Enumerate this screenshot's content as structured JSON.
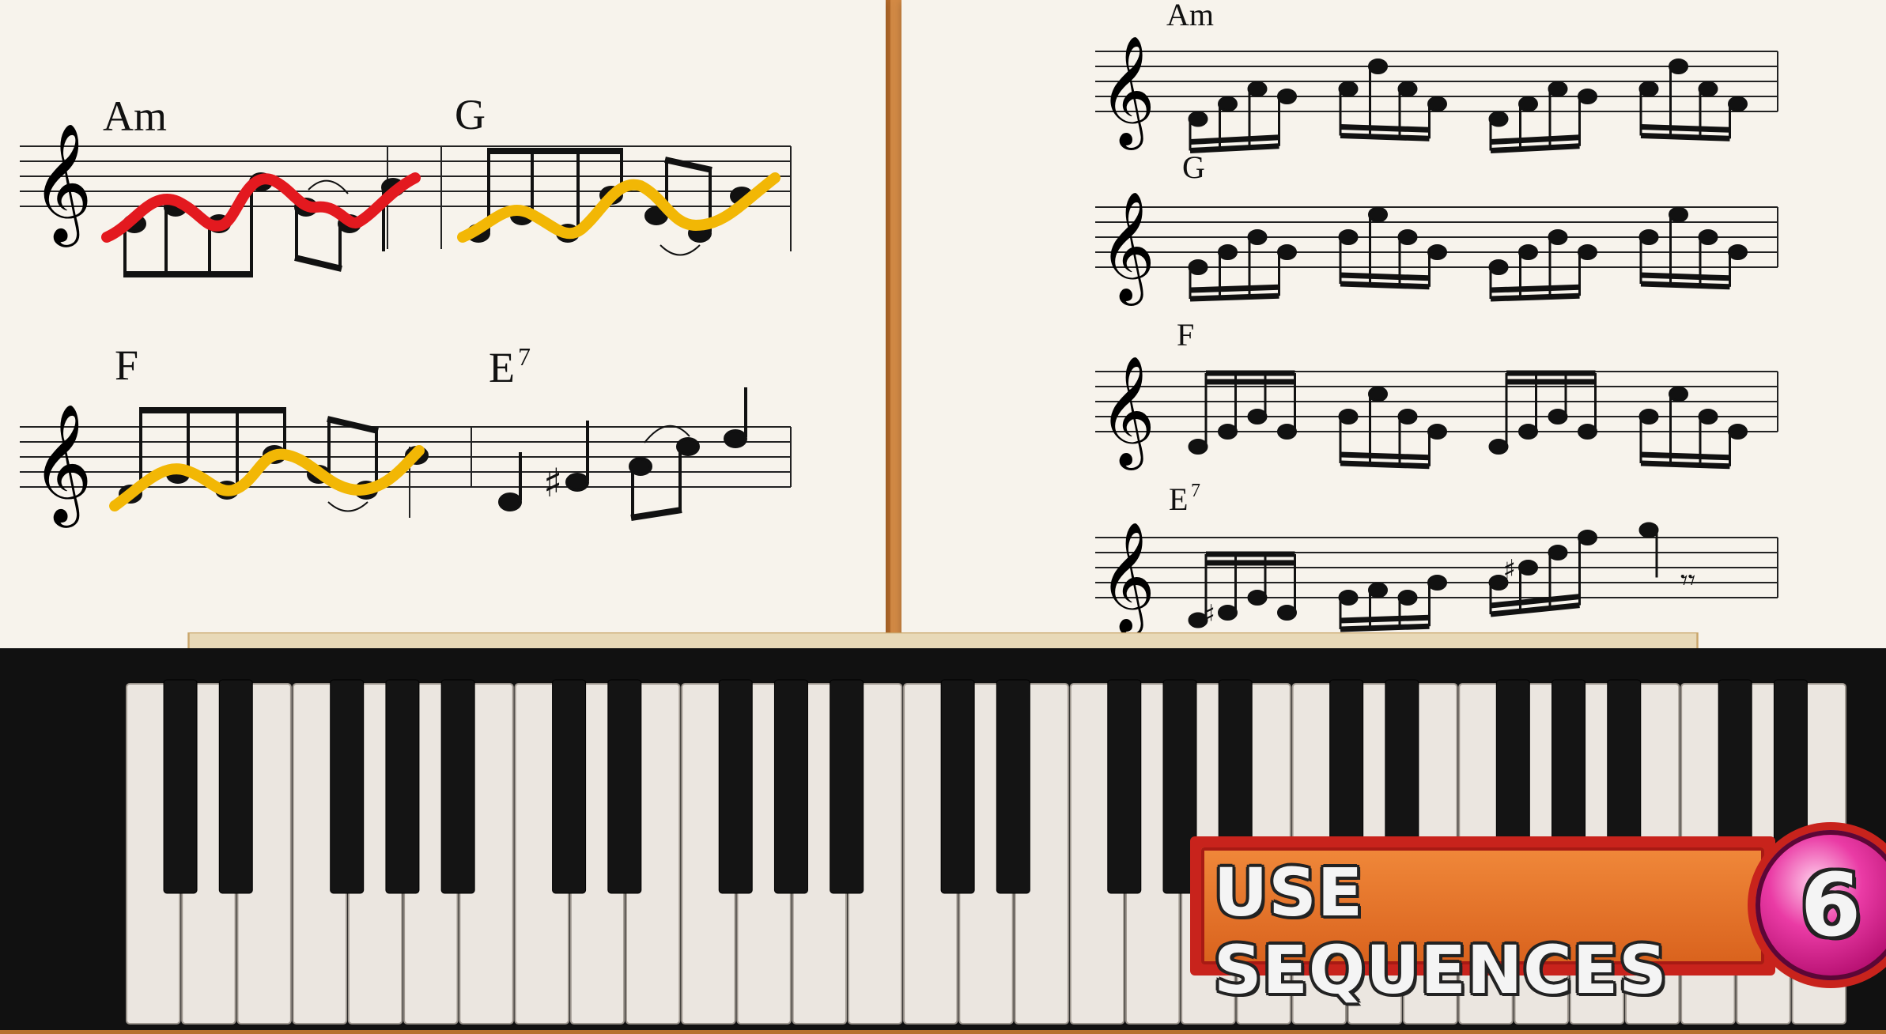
{
  "left_sheet": {
    "row1": {
      "chord1": "Am",
      "chord2": "G"
    },
    "row2": {
      "chord1": "F",
      "chord2_root": "E",
      "chord2_sup": "7"
    }
  },
  "right_sheet": {
    "chords": [
      {
        "root": "Am",
        "sup": ""
      },
      {
        "root": "G",
        "sup": ""
      },
      {
        "root": "F",
        "sup": ""
      },
      {
        "root": "E",
        "sup": "7"
      }
    ]
  },
  "badge": {
    "label": "USE SEQUENCES",
    "number": "6"
  },
  "colors": {
    "paper": "#f7f3ec",
    "red_line": "#e3191f",
    "yellow_line": "#f2b705",
    "badge_red": "#c8231c",
    "badge_orange": "#e06a22",
    "badge_pink": "#ea3ba5"
  },
  "keyboard": {
    "white_keys": 31
  }
}
